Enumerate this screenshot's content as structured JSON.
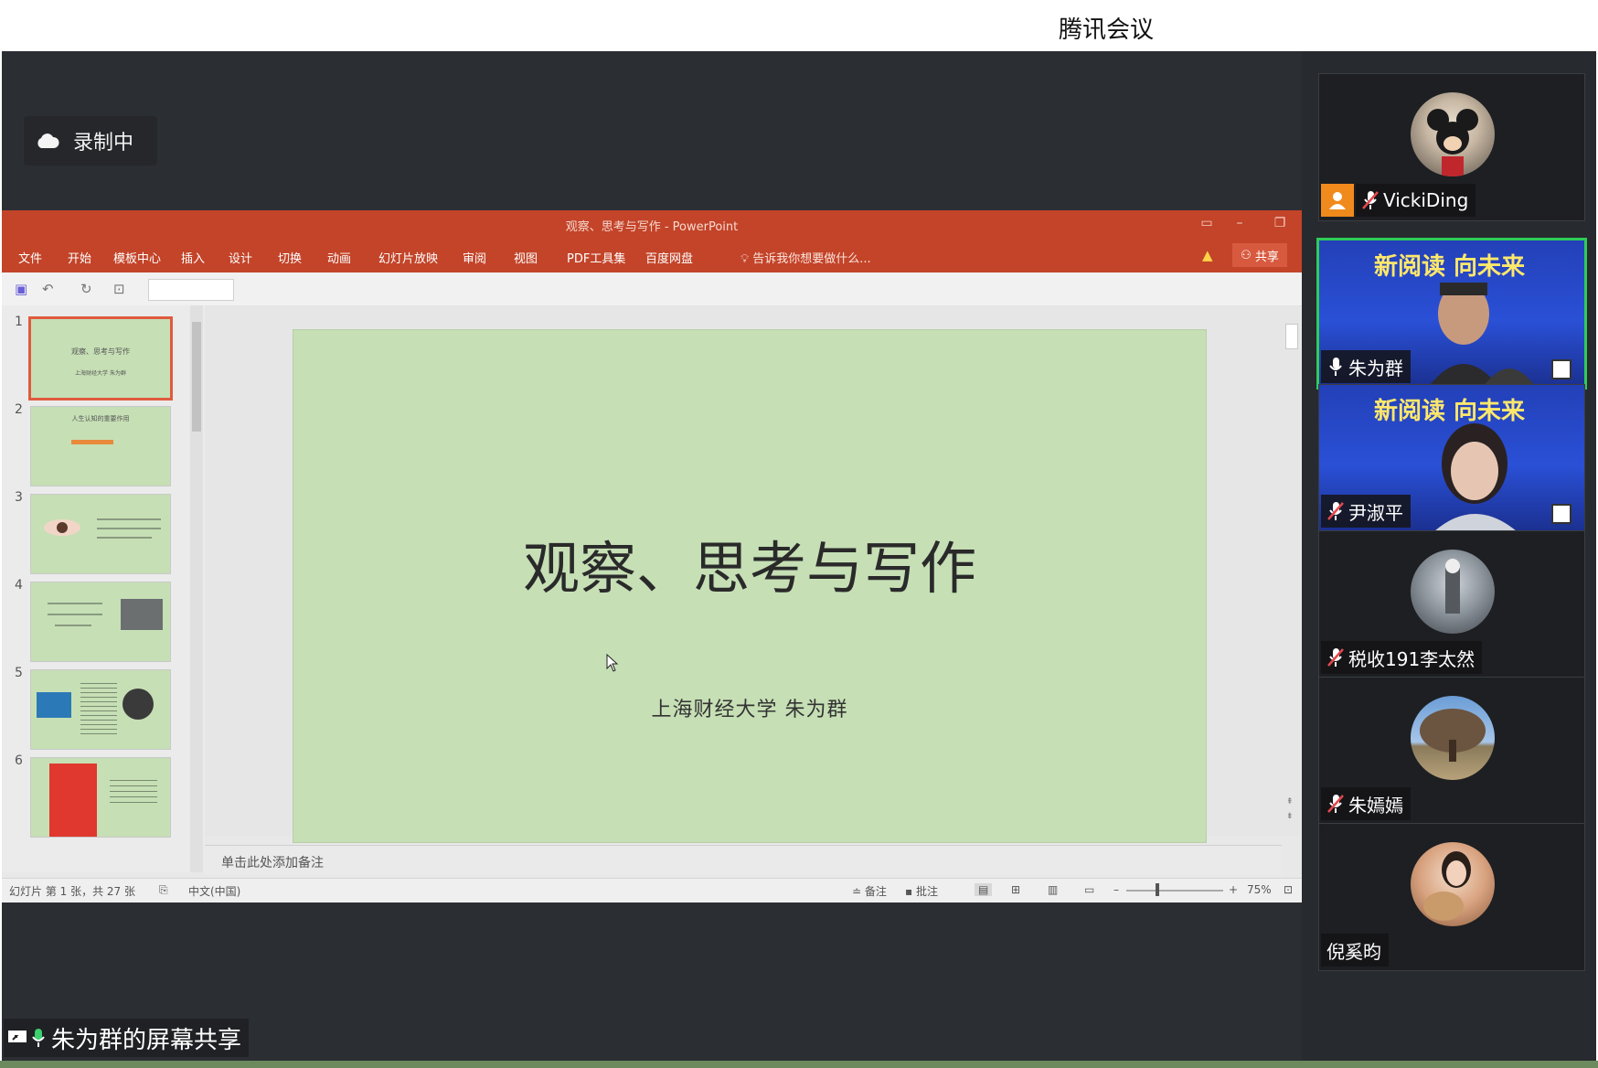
{
  "app": {
    "title": "腾讯会议"
  },
  "recording": {
    "label": "录制中"
  },
  "ppt": {
    "window_title": "观察、思考与写作 - PowerPoint",
    "menu": [
      "文件",
      "开始",
      "模板中心",
      "插入",
      "设计",
      "切换",
      "动画",
      "幻灯片放映",
      "审阅",
      "视图",
      "PDF工具集",
      "百度网盘"
    ],
    "tell_me": "告诉我你想要做什么...",
    "share": "共享",
    "thumbnails": [
      {
        "num": "1",
        "title": "观察、思考与写作",
        "sub": "上海财经大学 朱为群"
      },
      {
        "num": "2",
        "title": "人生认知的重要作用",
        "sub": ""
      },
      {
        "num": "3",
        "title": "",
        "sub": ""
      },
      {
        "num": "4",
        "title": "",
        "sub": ""
      },
      {
        "num": "5",
        "title": "",
        "sub": ""
      },
      {
        "num": "6",
        "title": "",
        "sub": ""
      }
    ],
    "slide": {
      "title": "观察、思考与写作",
      "subtitle": "上海财经大学  朱为群"
    },
    "notes_placeholder": "单击此处添加备注",
    "status": {
      "slide_info": "幻灯片 第 1 张，共 27 张",
      "language": "中文(中国)",
      "notes_btn": "备注",
      "comments_btn": "批注",
      "zoom": "75%"
    }
  },
  "screen_share": {
    "label": "朱为群的屏幕共享"
  },
  "participants": [
    {
      "name": "VickiDing",
      "muted": true,
      "type": "avatar"
    },
    {
      "name": "朱为群",
      "muted": false,
      "type": "video",
      "active": true,
      "banner": "新阅读 向未来"
    },
    {
      "name": "尹淑平",
      "muted": true,
      "type": "video",
      "banner": "新阅读 向未来"
    },
    {
      "name": "税收191李太然",
      "muted": true,
      "type": "avatar"
    },
    {
      "name": "朱嫣嫣",
      "muted": true,
      "type": "avatar"
    },
    {
      "name": "倪奚昀",
      "muted": false,
      "type": "avatar"
    }
  ]
}
